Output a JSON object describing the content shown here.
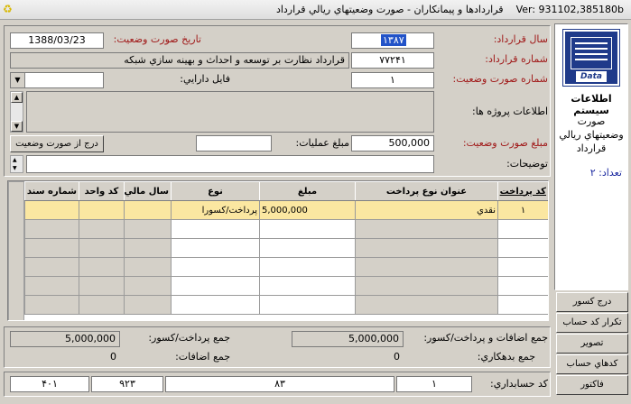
{
  "window": {
    "title": "قراردادها و پیمانکاران - صورت وضعیتهاي ریالي قرارداد",
    "version": "Ver: 931102,385180b"
  },
  "form": {
    "contract_year_label": "سال قرارداد:",
    "contract_year": "۱۳۸۷",
    "status_date_label": "تاریخ صورت وضعیت:",
    "status_date": "1388/03/23",
    "contract_number_label": "شماره قرارداد:",
    "contract_number": "۷۷۲۴۱",
    "contract_title": "قرارداد نظارت بر توسعه و احداث و بهینه سازي شبکه",
    "status_number_label": "شماره صورت وضعیت:",
    "status_number": "۱",
    "asset_file_label": "فايل دارايي:",
    "asset_file": "",
    "project_info_label": "اطلاعات پروژه ها:",
    "status_amount_label": "مبلغ صورت وضعیت:",
    "status_amount": "500,000",
    "operations_amount_label": "مبلغ عملیات:",
    "operations_amount": "",
    "insert_button": "درج از صورت وضعیت",
    "description_label": "توضیحات:",
    "description": ""
  },
  "sidebar": {
    "logo_text": "Data",
    "system_title": "اطلاعات سیستم",
    "system_desc": "صورت وضعیتهاي ريالي قرارداد",
    "count_label": "تعداد: ۲",
    "buttons": [
      "درج کسور",
      "تکرار کد حساب",
      "تصویر",
      "کدهاي حساب",
      "فاکتور"
    ]
  },
  "table": {
    "headers": [
      "کد پرداخت",
      "عنوان نوع پرداخت",
      "مبلغ",
      "نوع",
      "سال مالي",
      "کد واحد",
      "شماره سند"
    ],
    "rows": [
      [
        "۱",
        "نقدي",
        "5,000,000",
        "پرداخت/کسورا",
        "",
        "",
        ""
      ]
    ]
  },
  "totals": {
    "total_additions_payments_label": "جمع اضافات و پرداخت/کسور:",
    "total_additions_payments": "5,000,000",
    "total_debit_label": "جمع بدهکاري:",
    "total_debit": "0",
    "total_payments_label": "جمع پرداخت/کسور:",
    "total_payments": "5,000,000",
    "total_additions_label": "جمع اضافات:",
    "total_additions": "0"
  },
  "footer": {
    "accounting_code_label": "کد حسابداري:",
    "code_1": "۱",
    "code_2": "۸۳",
    "code_3": "۹۲۳",
    "code_4": "۴۰۱"
  }
}
